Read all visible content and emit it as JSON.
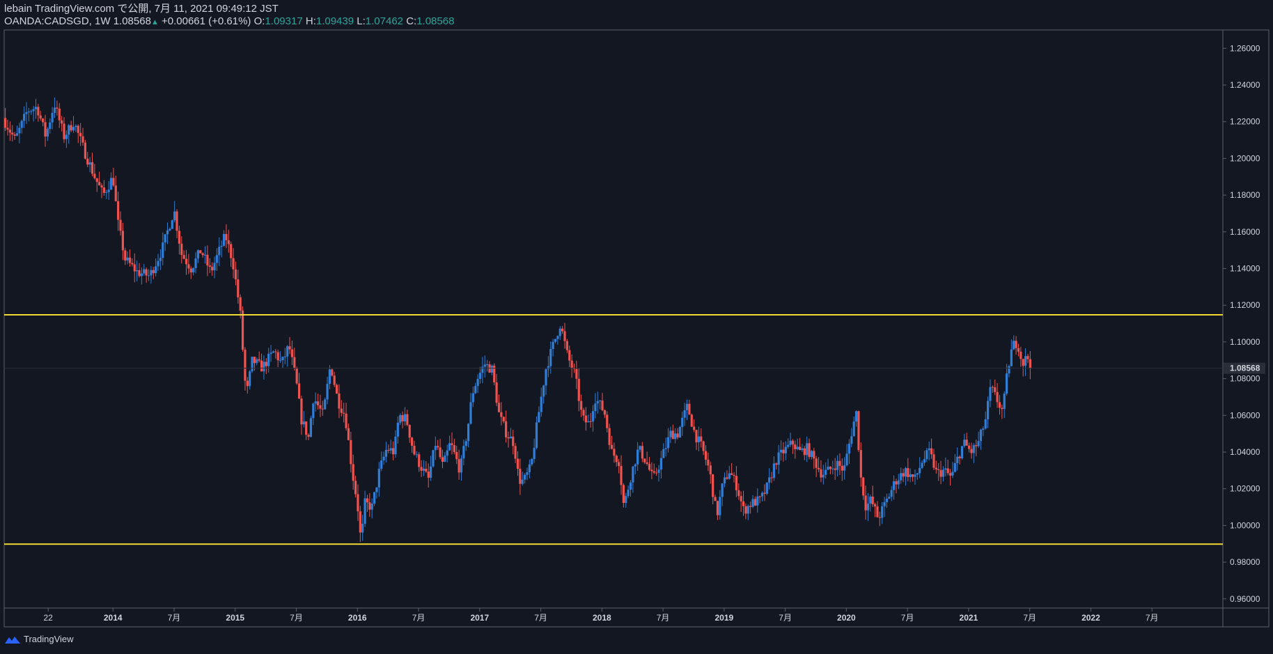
{
  "header": {
    "publisher": "lebain TradingView.com で公開, 7月 11, 2021 09:49:12 JST",
    "symbol": "OANDA:CADSGD, 1W",
    "last_price": "1.08568",
    "change": "+0.00661 (+0.61%)",
    "open_label": "O:",
    "open": "1.09317",
    "high_label": "H:",
    "high": "1.09439",
    "low_label": "L:",
    "low": "1.07462",
    "close_label": "C:",
    "close": "1.08568"
  },
  "footer": {
    "brand": "TradingView",
    "logo_icon": "tradingview-logo-icon"
  },
  "colors": {
    "background": "#131722",
    "up": "#2f7fd8",
    "down": "#ef5350",
    "level_line": "#f5d932",
    "axis": "#5d606b",
    "text": "#d1d4dc"
  },
  "chart_data": {
    "type": "candlestick",
    "timeframe": "1W",
    "y_ticks": [
      "1.26000",
      "1.24000",
      "1.22000",
      "1.20000",
      "1.18000",
      "1.16000",
      "1.14000",
      "1.12000",
      "1.10000",
      "1.08000",
      "1.06000",
      "1.04000",
      "1.02000",
      "1.00000",
      "0.98000",
      "0.96000"
    ],
    "ylim": [
      0.955,
      1.27
    ],
    "x_ticks": [
      {
        "label": "22",
        "t": 2013.47,
        "bold": false
      },
      {
        "label": "2014",
        "t": 2014.0,
        "bold": true
      },
      {
        "label": "7月",
        "t": 2014.5,
        "bold": false
      },
      {
        "label": "2015",
        "t": 2015.0,
        "bold": true
      },
      {
        "label": "7月",
        "t": 2015.5,
        "bold": false
      },
      {
        "label": "2016",
        "t": 2016.0,
        "bold": true
      },
      {
        "label": "7月",
        "t": 2016.5,
        "bold": false
      },
      {
        "label": "2017",
        "t": 2017.0,
        "bold": true
      },
      {
        "label": "7月",
        "t": 2017.5,
        "bold": false
      },
      {
        "label": "2018",
        "t": 2018.0,
        "bold": true
      },
      {
        "label": "7月",
        "t": 2018.5,
        "bold": false
      },
      {
        "label": "2019",
        "t": 2019.0,
        "bold": true
      },
      {
        "label": "7月",
        "t": 2019.5,
        "bold": false
      },
      {
        "label": "2020",
        "t": 2020.0,
        "bold": true
      },
      {
        "label": "7月",
        "t": 2020.5,
        "bold": false
      },
      {
        "label": "2021",
        "t": 2021.0,
        "bold": true
      },
      {
        "label": "7月",
        "t": 2021.5,
        "bold": false
      },
      {
        "label": "2022",
        "t": 2022.0,
        "bold": true
      },
      {
        "label": "7月",
        "t": 2022.5,
        "bold": false
      }
    ],
    "horizontal_levels": [
      1.1148,
      0.9898
    ],
    "last_price_label": "1.08568",
    "last_price": 1.08568,
    "price_path": [
      [
        2013.1,
        1.222
      ],
      [
        2013.2,
        1.21
      ],
      [
        2013.3,
        1.226
      ],
      [
        2013.38,
        1.228
      ],
      [
        2013.45,
        1.212
      ],
      [
        2013.52,
        1.23
      ],
      [
        2013.6,
        1.212
      ],
      [
        2013.68,
        1.22
      ],
      [
        2013.76,
        1.205
      ],
      [
        2013.85,
        1.19
      ],
      [
        2013.92,
        1.18
      ],
      [
        2014.0,
        1.19
      ],
      [
        2014.04,
        1.165
      ],
      [
        2014.1,
        1.145
      ],
      [
        2014.2,
        1.138
      ],
      [
        2014.3,
        1.136
      ],
      [
        2014.4,
        1.15
      ],
      [
        2014.5,
        1.172
      ],
      [
        2014.56,
        1.148
      ],
      [
        2014.64,
        1.14
      ],
      [
        2014.72,
        1.15
      ],
      [
        2014.8,
        1.138
      ],
      [
        2014.86,
        1.148
      ],
      [
        2014.92,
        1.158
      ],
      [
        2014.98,
        1.144
      ],
      [
        2015.04,
        1.117
      ],
      [
        2015.07,
        1.088
      ],
      [
        2015.09,
        1.07
      ],
      [
        2015.14,
        1.09
      ],
      [
        2015.22,
        1.086
      ],
      [
        2015.32,
        1.095
      ],
      [
        2015.38,
        1.088
      ],
      [
        2015.44,
        1.098
      ],
      [
        2015.5,
        1.078
      ],
      [
        2015.54,
        1.058
      ],
      [
        2015.6,
        1.048
      ],
      [
        2015.64,
        1.07
      ],
      [
        2015.72,
        1.06
      ],
      [
        2015.78,
        1.088
      ],
      [
        2015.84,
        1.068
      ],
      [
        2015.9,
        1.06
      ],
      [
        2015.96,
        1.028
      ],
      [
        2016.0,
        1.012
      ],
      [
        2016.03,
        0.99
      ],
      [
        2016.06,
        1.012
      ],
      [
        2016.12,
        1.01
      ],
      [
        2016.18,
        1.03
      ],
      [
        2016.24,
        1.042
      ],
      [
        2016.3,
        1.04
      ],
      [
        2016.34,
        1.06
      ],
      [
        2016.4,
        1.058
      ],
      [
        2016.46,
        1.04
      ],
      [
        2016.52,
        1.032
      ],
      [
        2016.58,
        1.025
      ],
      [
        2016.64,
        1.045
      ],
      [
        2016.7,
        1.032
      ],
      [
        2016.76,
        1.045
      ],
      [
        2016.84,
        1.03
      ],
      [
        2016.9,
        1.052
      ],
      [
        2016.94,
        1.072
      ],
      [
        2016.98,
        1.08
      ],
      [
        2017.04,
        1.088
      ],
      [
        2017.1,
        1.085
      ],
      [
        2017.16,
        1.06
      ],
      [
        2017.22,
        1.05
      ],
      [
        2017.28,
        1.045
      ],
      [
        2017.32,
        1.025
      ],
      [
        2017.36,
        1.024
      ],
      [
        2017.42,
        1.032
      ],
      [
        2017.48,
        1.06
      ],
      [
        2017.54,
        1.085
      ],
      [
        2017.6,
        1.098
      ],
      [
        2017.66,
        1.11
      ],
      [
        2017.72,
        1.092
      ],
      [
        2017.78,
        1.082
      ],
      [
        2017.84,
        1.058
      ],
      [
        2017.9,
        1.055
      ],
      [
        2017.94,
        1.07
      ],
      [
        2018.02,
        1.062
      ],
      [
        2018.08,
        1.04
      ],
      [
        2018.14,
        1.035
      ],
      [
        2018.18,
        1.01
      ],
      [
        2018.24,
        1.028
      ],
      [
        2018.3,
        1.042
      ],
      [
        2018.36,
        1.035
      ],
      [
        2018.42,
        1.025
      ],
      [
        2018.48,
        1.035
      ],
      [
        2018.56,
        1.05
      ],
      [
        2018.62,
        1.05
      ],
      [
        2018.7,
        1.065
      ],
      [
        2018.76,
        1.05
      ],
      [
        2018.82,
        1.042
      ],
      [
        2018.88,
        1.03
      ],
      [
        2018.94,
        1.005
      ],
      [
        2018.98,
        1.02
      ],
      [
        2019.04,
        1.03
      ],
      [
        2019.1,
        1.022
      ],
      [
        2019.16,
        1.008
      ],
      [
        2019.22,
        1.012
      ],
      [
        2019.3,
        1.014
      ],
      [
        2019.36,
        1.022
      ],
      [
        2019.42,
        1.035
      ],
      [
        2019.48,
        1.04
      ],
      [
        2019.56,
        1.045
      ],
      [
        2019.62,
        1.04
      ],
      [
        2019.68,
        1.042
      ],
      [
        2019.74,
        1.035
      ],
      [
        2019.8,
        1.028
      ],
      [
        2019.86,
        1.03
      ],
      [
        2019.92,
        1.034
      ],
      [
        2019.98,
        1.03
      ],
      [
        2020.04,
        1.05
      ],
      [
        2020.08,
        1.062
      ],
      [
        2020.12,
        1.025
      ],
      [
        2020.16,
        1.01
      ],
      [
        2020.2,
        1.014
      ],
      [
        2020.26,
        1.004
      ],
      [
        2020.32,
        1.012
      ],
      [
        2020.4,
        1.024
      ],
      [
        2020.48,
        1.03
      ],
      [
        2020.56,
        1.025
      ],
      [
        2020.62,
        1.035
      ],
      [
        2020.68,
        1.04
      ],
      [
        2020.74,
        1.028
      ],
      [
        2020.8,
        1.03
      ],
      [
        2020.86,
        1.026
      ],
      [
        2020.9,
        1.035
      ],
      [
        2020.96,
        1.045
      ],
      [
        2021.02,
        1.04
      ],
      [
        2021.08,
        1.045
      ],
      [
        2021.14,
        1.058
      ],
      [
        2021.18,
        1.075
      ],
      [
        2021.22,
        1.07
      ],
      [
        2021.28,
        1.062
      ],
      [
        2021.32,
        1.085
      ],
      [
        2021.36,
        1.098
      ],
      [
        2021.4,
        1.1
      ],
      [
        2021.44,
        1.088
      ],
      [
        2021.48,
        1.092
      ],
      [
        2021.52,
        1.0857
      ]
    ],
    "series": [
      {
        "name": "OANDA:CADSGD",
        "values": "weekly OHLC candles approximated from price_path"
      }
    ]
  }
}
